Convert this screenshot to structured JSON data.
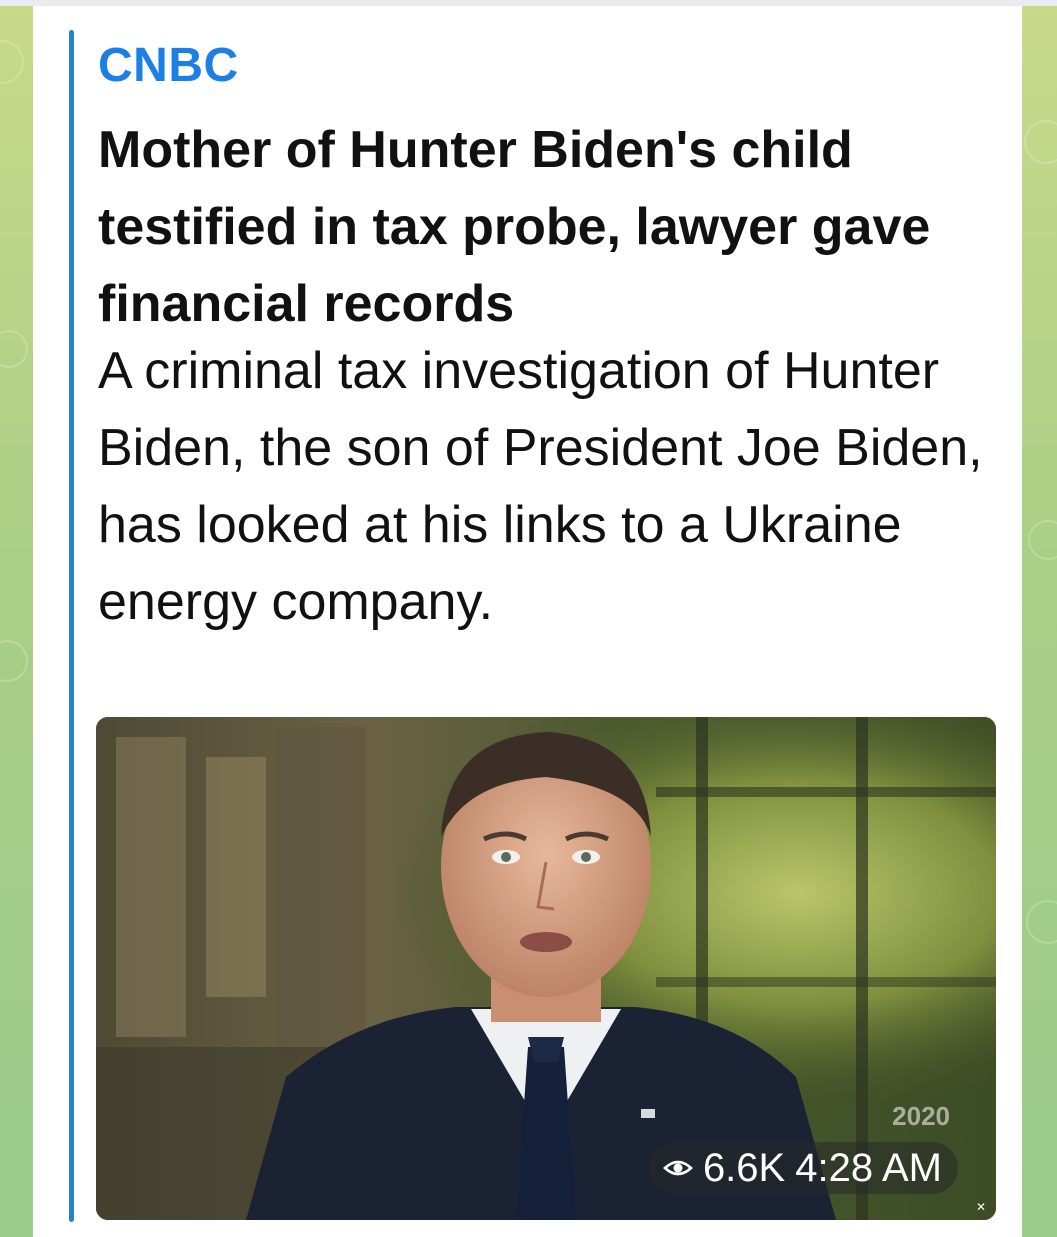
{
  "post": {
    "source": "CNBC",
    "headline": "Mother of Hunter Biden's child testified in tax probe, lawyer gave financial records",
    "description": "A criminal tax investigation of Hunter Biden, the son of President Joe Biden, has looked at his links to a Ukraine energy company.",
    "views": "6.6K",
    "time": "4:28 AM",
    "watermark": "2020",
    "view_icon": "eye-icon"
  },
  "colors": {
    "source_link": "#1c7fe6",
    "accent_bar": "#2481cc",
    "wallpaper": "#a9cf86"
  }
}
